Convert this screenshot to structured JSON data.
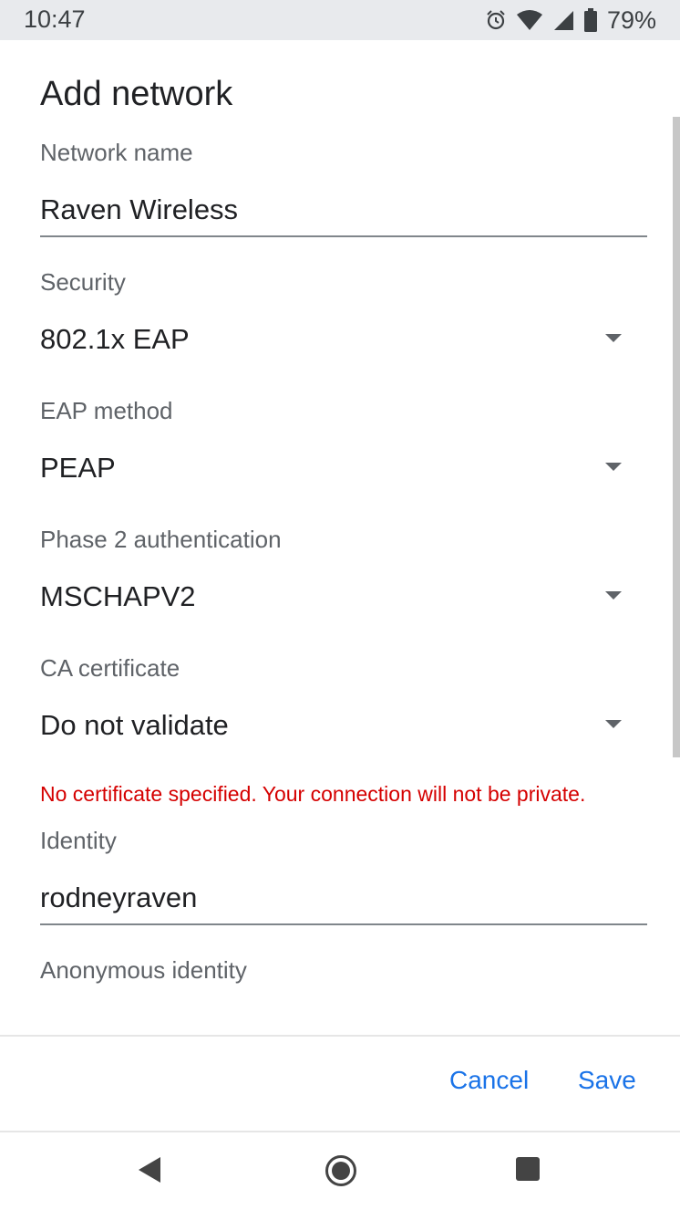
{
  "status_bar": {
    "time": "10:47",
    "battery": "79%",
    "icons": [
      "alarm-icon",
      "wifi-icon",
      "signal-icon",
      "battery-icon"
    ]
  },
  "dialog": {
    "title": "Add network",
    "network_name": {
      "label": "Network name",
      "value": "Raven Wireless"
    },
    "security": {
      "label": "Security",
      "value": "802.1x EAP"
    },
    "eap_method": {
      "label": "EAP method",
      "value": "PEAP"
    },
    "phase2": {
      "label": "Phase 2 authentication",
      "value": "MSCHAPV2"
    },
    "ca_certificate": {
      "label": "CA certificate",
      "value": "Do not validate"
    },
    "warning": "No certificate specified. Your connection will not be private.",
    "identity": {
      "label": "Identity",
      "value": "rodneyraven"
    },
    "anonymous_identity": {
      "label": "Anonymous identity"
    },
    "cancel_label": "Cancel",
    "save_label": "Save"
  },
  "colors": {
    "accent": "#1a73e8",
    "warning": "#d50000",
    "status_bar_bg": "#e8eaed"
  }
}
